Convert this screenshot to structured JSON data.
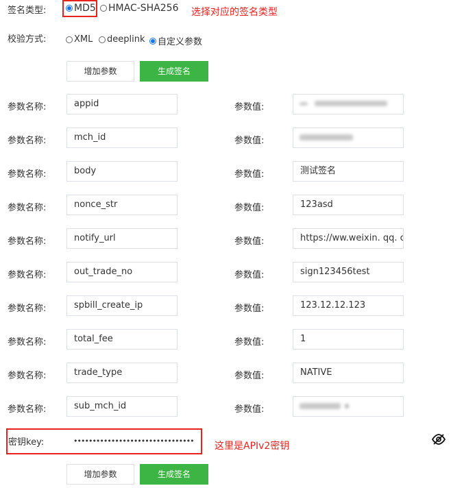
{
  "signature_type": {
    "label": "签名类型:",
    "options": [
      {
        "text": "MD5",
        "selected": true
      },
      {
        "text": "HMAC-SHA256",
        "selected": false
      }
    ],
    "annotation": "选择对应的签名类型"
  },
  "verify_method": {
    "label": "校验方式:",
    "options": [
      {
        "text": "XML",
        "selected": false
      },
      {
        "text": "deeplink",
        "selected": false
      },
      {
        "text": "自定义参数",
        "selected": true
      }
    ]
  },
  "buttons": {
    "add_param": "增加参数",
    "generate_sign": "生成签名"
  },
  "param_name_label": "参数名称:",
  "param_value_label": "参数值:",
  "params": [
    {
      "name": "appid",
      "value": ""
    },
    {
      "name": "mch_id",
      "value": ""
    },
    {
      "name": "body",
      "value": "测试签名"
    },
    {
      "name": "nonce_str",
      "value": "123asd"
    },
    {
      "name": "notify_url",
      "value": "https://ww.weixin. qq. c"
    },
    {
      "name": "out_trade_no",
      "value": "sign123456test"
    },
    {
      "name": "spbill_create_ip",
      "value": "123.12.12.123"
    },
    {
      "name": "total_fee",
      "value": "1"
    },
    {
      "name": "trade_type",
      "value": "NATIVE"
    },
    {
      "name": "sub_mch_id",
      "value": ""
    }
  ],
  "secret_key": {
    "label": "密钥key:",
    "value": "••••••••••••••••••••••••••••••••",
    "annotation": "这里是APIv2密钥",
    "toggle_icon": "eye-slash-icon"
  },
  "colors": {
    "accent_red": "#e8231f",
    "button_green": "#3db545",
    "radio_blue": "#1a73e8"
  }
}
